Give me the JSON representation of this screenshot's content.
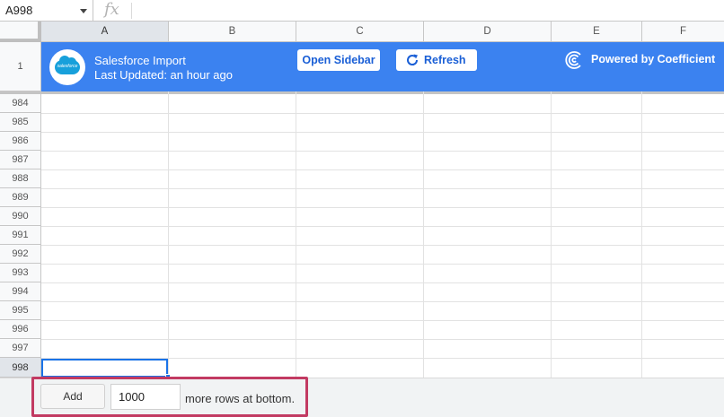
{
  "formula_bar": {
    "name_box": "A998",
    "fx_label": "fx",
    "formula": ""
  },
  "columns": [
    "A",
    "B",
    "C",
    "D",
    "E",
    "F"
  ],
  "selected_column": "A",
  "banner": {
    "row_number": "1",
    "logo_text": "salesforce",
    "title": "Salesforce Import",
    "subtitle": "Last Updated: an hour ago",
    "open_sidebar_label": "Open Sidebar",
    "refresh_label": "Refresh",
    "powered_by": "Powered by Coefficient",
    "colors": {
      "banner": "#3b82f0",
      "button_text": "#1a5fd6"
    }
  },
  "rows": [
    "984",
    "985",
    "986",
    "987",
    "988",
    "989",
    "990",
    "991",
    "992",
    "993",
    "994",
    "995",
    "996",
    "997",
    "998"
  ],
  "selected_row": "998",
  "bottom": {
    "add_label": "Add",
    "rows_value": "1000",
    "suffix": "more rows at bottom.",
    "highlight_color": "#c23a62"
  }
}
